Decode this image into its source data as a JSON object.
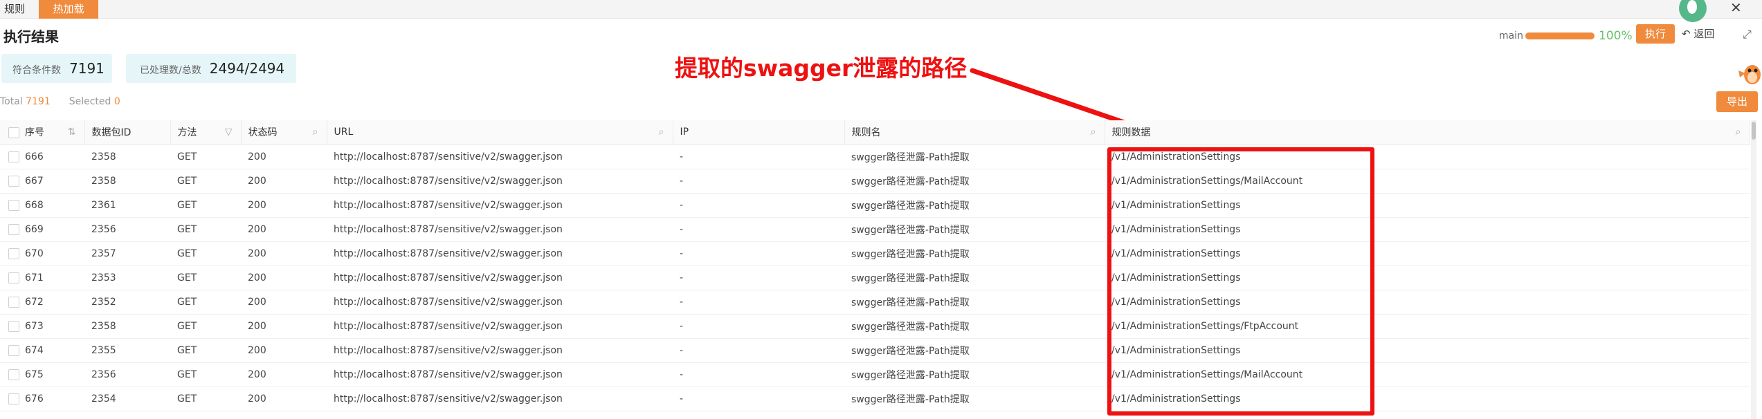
{
  "topbar": {
    "tab_rules": "规则",
    "tab_hot_loading": "热加载",
    "close": "✕"
  },
  "page_title": "执行结果",
  "status": {
    "branch": "main",
    "progress_percent": 100,
    "percent_label": "100%",
    "run_label": "执行",
    "back_label": "返回"
  },
  "stats": {
    "match_label": "符合条件数",
    "match_value": "7191",
    "processed_label": "已处理数/总数",
    "processed_value": "2494/2494"
  },
  "counts": {
    "total_label": "Total",
    "total_value": "7191",
    "selected_label": "Selected",
    "selected_value": "0"
  },
  "export_label": "导出",
  "annotation": "提取的swagger泄露的路径",
  "colors": {
    "accent": "#f08a3c",
    "annotation": "#ee1111",
    "success": "#6cc06c",
    "stat_bg": "#e6f6f8"
  },
  "table": {
    "headers": {
      "seq": "序号",
      "packet_id": "数据包ID",
      "method": "方法",
      "status_code": "状态码",
      "url": "URL",
      "ip": "IP",
      "rule_name": "规则名",
      "rule_data": "规则数据"
    },
    "rows": [
      {
        "seq": "666",
        "packet_id": "2358",
        "method": "GET",
        "status": "200",
        "url": "http://localhost:8787/sensitive/v2/swagger.json",
        "ip": "-",
        "rule": "swgger路径泄露-Path提取",
        "data": "/v1/AdministrationSettings"
      },
      {
        "seq": "667",
        "packet_id": "2358",
        "method": "GET",
        "status": "200",
        "url": "http://localhost:8787/sensitive/v2/swagger.json",
        "ip": "-",
        "rule": "swgger路径泄露-Path提取",
        "data": "/v1/AdministrationSettings/MailAccount"
      },
      {
        "seq": "668",
        "packet_id": "2361",
        "method": "GET",
        "status": "200",
        "url": "http://localhost:8787/sensitive/v2/swagger.json",
        "ip": "-",
        "rule": "swgger路径泄露-Path提取",
        "data": "/v1/AdministrationSettings"
      },
      {
        "seq": "669",
        "packet_id": "2356",
        "method": "GET",
        "status": "200",
        "url": "http://localhost:8787/sensitive/v2/swagger.json",
        "ip": "-",
        "rule": "swgger路径泄露-Path提取",
        "data": "/v1/AdministrationSettings"
      },
      {
        "seq": "670",
        "packet_id": "2357",
        "method": "GET",
        "status": "200",
        "url": "http://localhost:8787/sensitive/v2/swagger.json",
        "ip": "-",
        "rule": "swgger路径泄露-Path提取",
        "data": "/v1/AdministrationSettings"
      },
      {
        "seq": "671",
        "packet_id": "2353",
        "method": "GET",
        "status": "200",
        "url": "http://localhost:8787/sensitive/v2/swagger.json",
        "ip": "-",
        "rule": "swgger路径泄露-Path提取",
        "data": "/v1/AdministrationSettings"
      },
      {
        "seq": "672",
        "packet_id": "2352",
        "method": "GET",
        "status": "200",
        "url": "http://localhost:8787/sensitive/v2/swagger.json",
        "ip": "-",
        "rule": "swgger路径泄露-Path提取",
        "data": "/v1/AdministrationSettings"
      },
      {
        "seq": "673",
        "packet_id": "2358",
        "method": "GET",
        "status": "200",
        "url": "http://localhost:8787/sensitive/v2/swagger.json",
        "ip": "-",
        "rule": "swgger路径泄露-Path提取",
        "data": "/v1/AdministrationSettings/FtpAccount"
      },
      {
        "seq": "674",
        "packet_id": "2355",
        "method": "GET",
        "status": "200",
        "url": "http://localhost:8787/sensitive/v2/swagger.json",
        "ip": "-",
        "rule": "swgger路径泄露-Path提取",
        "data": "/v1/AdministrationSettings"
      },
      {
        "seq": "675",
        "packet_id": "2356",
        "method": "GET",
        "status": "200",
        "url": "http://localhost:8787/sensitive/v2/swagger.json",
        "ip": "-",
        "rule": "swgger路径泄露-Path提取",
        "data": "/v1/AdministrationSettings/MailAccount"
      },
      {
        "seq": "676",
        "packet_id": "2354",
        "method": "GET",
        "status": "200",
        "url": "http://localhost:8787/sensitive/v2/swagger.json",
        "ip": "-",
        "rule": "swgger路径泄露-Path提取",
        "data": "/v1/AdministrationSettings"
      }
    ]
  }
}
